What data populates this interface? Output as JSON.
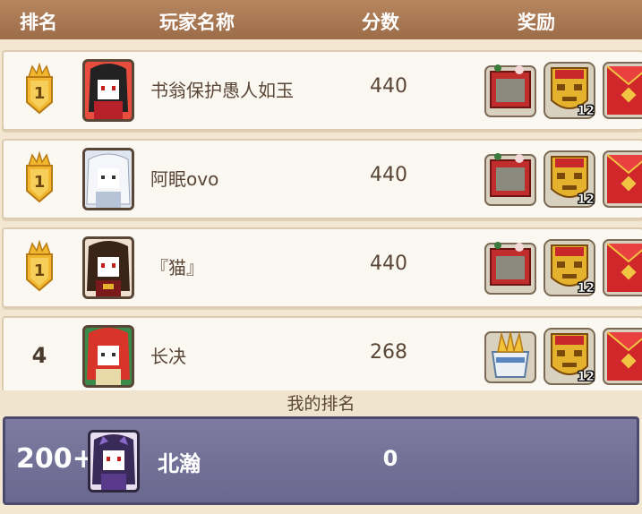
{
  "header": {
    "rank_col": "排名",
    "name_col": "玩家名称",
    "score_col": "分数",
    "reward_col": "奖励"
  },
  "rows": [
    {
      "rank": "1",
      "badge": "gold-crown",
      "name": "书翁保护愚人如玉",
      "score": "440",
      "rewards": [
        {
          "icon": "chest-icon"
        },
        {
          "icon": "golden-mask-icon",
          "qty": "12"
        },
        {
          "icon": "red-envelope-icon"
        }
      ]
    },
    {
      "rank": "1",
      "badge": "gold-crown",
      "name": "阿眠ovo",
      "score": "440",
      "rewards": [
        {
          "icon": "chest-icon"
        },
        {
          "icon": "golden-mask-icon",
          "qty": "12"
        },
        {
          "icon": "red-envelope-icon"
        }
      ]
    },
    {
      "rank": "1",
      "badge": "gold-crown",
      "name": "『猫』",
      "score": "440",
      "rewards": [
        {
          "icon": "chest-icon"
        },
        {
          "icon": "golden-mask-icon",
          "qty": "12"
        },
        {
          "icon": "red-envelope-icon"
        }
      ]
    },
    {
      "rank": "4",
      "badge": "",
      "name": "长决",
      "score": "268",
      "rewards": [
        {
          "icon": "treasure-box-icon"
        },
        {
          "icon": "golden-mask-icon",
          "qty": "12"
        },
        {
          "icon": "red-envelope-icon"
        }
      ]
    }
  ],
  "my_rank": {
    "label": "我的排名",
    "rank": "200+",
    "name": "北瀚",
    "score": "0"
  },
  "colors": {
    "header_bg": "#a87654",
    "my_row_bg": "#75739a",
    "gold": "#e8b534",
    "red": "#c8282a"
  }
}
